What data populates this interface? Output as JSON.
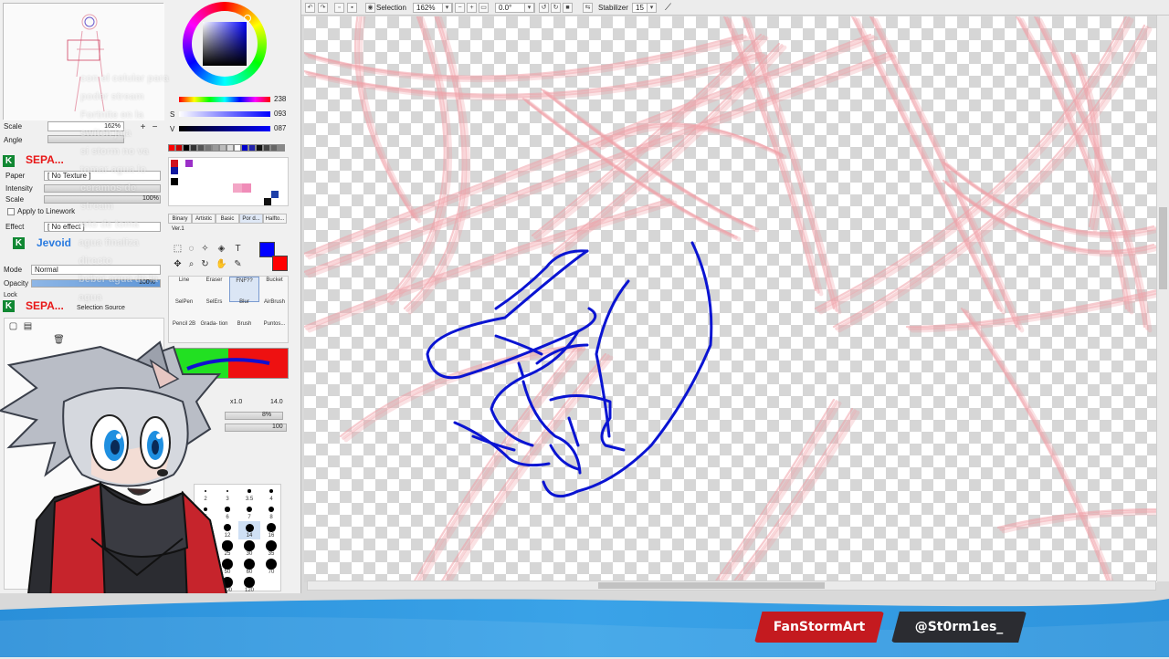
{
  "toolbar": {
    "selection_label": "Selection",
    "zoom": "162%",
    "rotation": "0.0°",
    "stabilizer_label": "Stabilizer",
    "stabilizer_value": "15"
  },
  "navigator": {
    "scale_label": "Scale",
    "scale_value": "162%",
    "angle_label": "Angle"
  },
  "color": {
    "h_value": "238",
    "s_label": "S",
    "s_value": "093",
    "v_label": "V",
    "v_value": "087",
    "primary": "#0000ff",
    "secondary": "#ff0000",
    "palette": [
      "#ff0000",
      "#cc0000",
      "#000000",
      "#333333",
      "#555555",
      "#777777",
      "#999999",
      "#bbbbbb",
      "#dddddd",
      "#ffffff",
      "#0000cc",
      "#2222aa",
      "#111111",
      "#444444",
      "#666666",
      "#888888"
    ]
  },
  "texture": {
    "paper_label": "Paper",
    "paper_value": "[ No Texture ]",
    "intensity_label": "Intensity",
    "scale_label": "Scale",
    "scale_value": "100%",
    "apply_linework": "Apply to Linework",
    "effect_label": "Effect",
    "effect_value": "[ No effect ]"
  },
  "layer": {
    "mode_label": "Mode",
    "mode_value": "Normal",
    "opacity_label": "Opacity",
    "opacity_value": "100%",
    "lock_label": "Lock",
    "selection_source": "Selection Source"
  },
  "brush_tabs": [
    "Binary",
    "Artistic",
    "Basic",
    "Por d...",
    "Halfto..."
  ],
  "brush_version": "Ver.1",
  "brushes": [
    {
      "label": "Line"
    },
    {
      "label": "Eraser"
    },
    {
      "label": "FNF??"
    },
    {
      "label": "Bucket"
    },
    {
      "label": "SelPen"
    },
    {
      "label": "SelErs"
    },
    {
      "label": "Blur"
    },
    {
      "label": "AirBrush"
    },
    {
      "label": "Pencil 2B"
    },
    {
      "label": "Grada- tion"
    },
    {
      "label": "Brush"
    },
    {
      "label": "Puntos..."
    }
  ],
  "brush_size": {
    "multiplier": "x1.0",
    "value": "14.0",
    "min_size": "8%",
    "density": "100",
    "sizes": [
      "2",
      "3",
      "3.5",
      "4",
      "5",
      "6",
      "7",
      "8",
      "10",
      "12",
      "14",
      "16",
      "20",
      "25",
      "30",
      "35",
      "40",
      "50",
      "60",
      "70",
      "80",
      "100",
      "120"
    ]
  },
  "chat_overlay": {
    "k_badge": "K",
    "user1": "SEPA...",
    "user2": "Jevoid",
    "user3": "SEPA...",
    "lines": [
      "con el celular para",
      "poder stream",
      "Fortnite en la",
      "switch jaja",
      "si storm no va",
      "tomar agua lo",
      "ceramos de",
      "stream",
      "reto de toma",
      "agua finaliza",
      "directo",
      "beber agua de la",
      "agua"
    ]
  },
  "socials": {
    "twitter": "FanStormArt",
    "instagram": "@St0rm1es_"
  },
  "colors": {
    "sketch": "#f0a0a8",
    "lineart": "#0a14d2",
    "bar_blue": "#2d93dc"
  }
}
